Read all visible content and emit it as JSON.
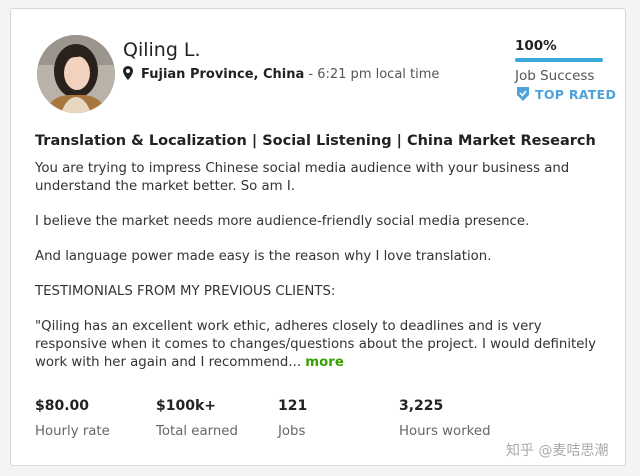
{
  "profile": {
    "name": "Qiling L.",
    "location": "Fujian Province, China",
    "local_time": " - 6:21 pm local time",
    "job_success": {
      "percent_label": "100%",
      "label": "Job Success",
      "value": 1.0
    },
    "badge": "TOP RATED"
  },
  "overview": {
    "headline": "Translation & Localization | Social Listening | China Market Research",
    "paragraphs": [
      "You are trying to impress Chinese social media audience with your business and understand the market better. So am I.",
      "I believe the market needs more audience-friendly social media presence.",
      "And language power made easy is the reason why I love translation.",
      "TESTIMONIALS FROM MY PREVIOUS CLIENTS:"
    ],
    "testimonial": "\"Qiling has an excellent work ethic, adheres closely to deadlines and is very responsive when it comes to changes/questions about the project. I would definitely work with her again and I recommend...",
    "more_label": "more"
  },
  "stats": [
    {
      "value": "$80.00",
      "label": "Hourly rate"
    },
    {
      "value": "$100k+",
      "label": "Total earned"
    },
    {
      "value": "121",
      "label": "Jobs"
    },
    {
      "value": "3,225",
      "label": "Hours worked"
    }
  ],
  "watermark": "知乎 @麦咭思潮",
  "colors": {
    "accent_blue": "#3aa7d9",
    "more_green": "#37a000",
    "badge_blue": "#4ea2d8"
  }
}
